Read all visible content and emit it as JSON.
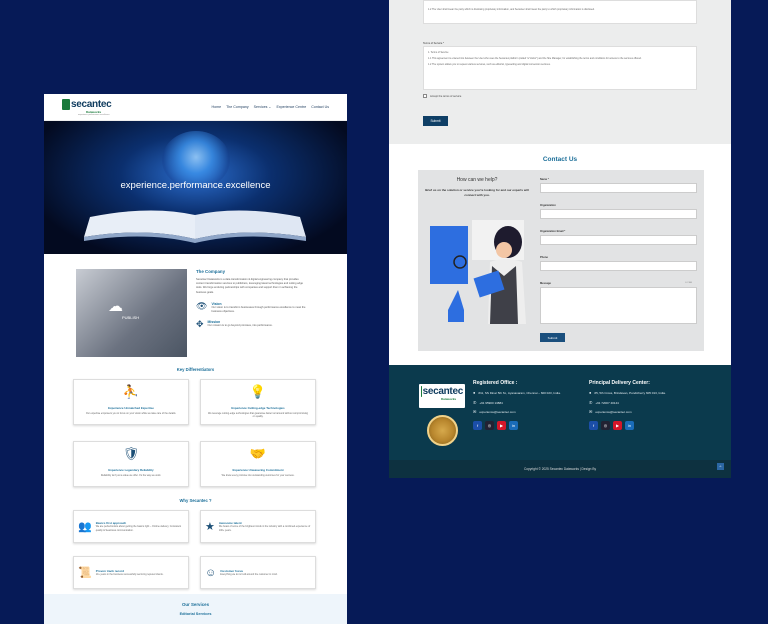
{
  "left": {
    "logo": {
      "name": "secantec",
      "sub": "Dataworks",
      "tag": "experience performance excellence"
    },
    "menu": [
      "Home",
      "The Company",
      "Services ⌄",
      "Experience Centre",
      "Contact Us"
    ],
    "hero_title": "experience.performance.excellence",
    "company": {
      "title": "The Company",
      "text": "Secantec Dataworks is a data transformation & digital engineering company that provides content transformation services to publishers, leveraging latest technologies and cutting edge tools. We forge enduring partnerships with companies and support them in achieving the business goals.",
      "image_text": "PUBLISH",
      "vision_title": "Vision",
      "vision_text": "Our vision is to transform businesses through performance excellence to meet the business objectives.",
      "mission_title": "Mission",
      "mission_text": "Our mission is to go beyond promises, into performance."
    },
    "key_title": "Key Differentiators",
    "key_cards": [
      {
        "icon": "team-hierarchy-icon",
        "glyph": "⛹",
        "title": "Experience Unmatched Expertise",
        "text": "Our expertise empowers you to focus on your vision while we take care of the details."
      },
      {
        "icon": "lightbulb-icon",
        "glyph": "💡",
        "title": "Experience Cutting-edge Technologies",
        "text": "We leverage cutting-edge technologies that guarantee faster turnaround without compromising on quality."
      },
      {
        "icon": "hand-shield-icon",
        "glyph": "🛡",
        "title": "Experience Legendary Reliability",
        "text": "Reliability isn't just a value we offer. It's the way we work."
      },
      {
        "icon": "handshake-icon",
        "glyph": "🤝",
        "title": "Experience Unwavering Commitment",
        "text": "We know every promise into outstanding outcomes for your success."
      }
    ],
    "why_title": "Why Secantec ?",
    "why_cards": [
      {
        "icon": "people-group-icon",
        "glyph": "👥",
        "title": "Basics first approach",
        "text": "We are perfectionists about getting the basics right – Ontime delivery, Consistent quality & Seamless communication."
      },
      {
        "icon": "team-star-icon",
        "glyph": "★",
        "title": "Awesome talent",
        "text": "We boast of some of the brightest minds in the industry with a combined experience of 100+ years."
      },
      {
        "icon": "certificate-icon",
        "glyph": "📜",
        "title": "Proven track record",
        "text": "10+ years in the business successfully servicing reputed clients."
      },
      {
        "icon": "customer-focus-icon",
        "glyph": "☺",
        "title": "Customer focus",
        "text": "Everything we do is built around the customer in mind."
      }
    ],
    "services_title": "Our Services",
    "services_sub": "Editorial Services"
  },
  "right": {
    "ta1_text": "1.2 The User shall mean the party which is disclosing proprietary information, and Secantec shall mean the party to which proprietary information is disclosed.",
    "terms_label": "Terms of Service *",
    "terms_lines": [
      "1. Terms of Service",
      "1.1 This agreement is entered into between the User who uses the Secantec platform (called \"a Visitor\") and the Site Manager, for establishing the terms and conditions for access to the services offered.",
      "1.2 The system allows you to request various services, such as editorial, typesetting and digital conversion services."
    ],
    "accept_label": "Accept the terms of service",
    "submit": "Submit",
    "contact_title": "Contact Us",
    "help_title": "How can we help?",
    "help_text": "Brief us on the solution or service you're looking for and our experts will connect with you.",
    "fields": [
      "Name *",
      "Organization",
      "Organization Email *",
      "Phone",
      "Message"
    ],
    "char_count": "0 / 180",
    "form_submit": "Submit",
    "footer": {
      "logo_name": "secantec",
      "logo_sub": "Dataworks",
      "reg_title": "Registered Office :",
      "reg_address": "#11, SS Dinar 5th St., Ayanavaram, Chennai – 600 023, India.",
      "reg_phone": "+91 95900 13884",
      "reg_email": "experience@secantec.com",
      "del_title": "Principal Delivery Center:",
      "del_address": "#5, 5th Cross, Brindavan, Pondicherry 605 013, India.",
      "del_phone": "+91 72007 40144",
      "del_email": "experience@secantec.com",
      "social": [
        {
          "name": "facebook-icon",
          "glyph": "f",
          "color": "#1b4ea8"
        },
        {
          "name": "instagram-icon",
          "glyph": "◎",
          "color": "#223"
        },
        {
          "name": "youtube-icon",
          "glyph": "▶",
          "color": "#d4172a"
        },
        {
          "name": "linkedin-icon",
          "glyph": "in",
          "color": "#1a6cb8"
        }
      ],
      "copyright": "Copyright © 2025 Secantec Dataworks | Design By",
      "top_arrow": "^"
    }
  }
}
